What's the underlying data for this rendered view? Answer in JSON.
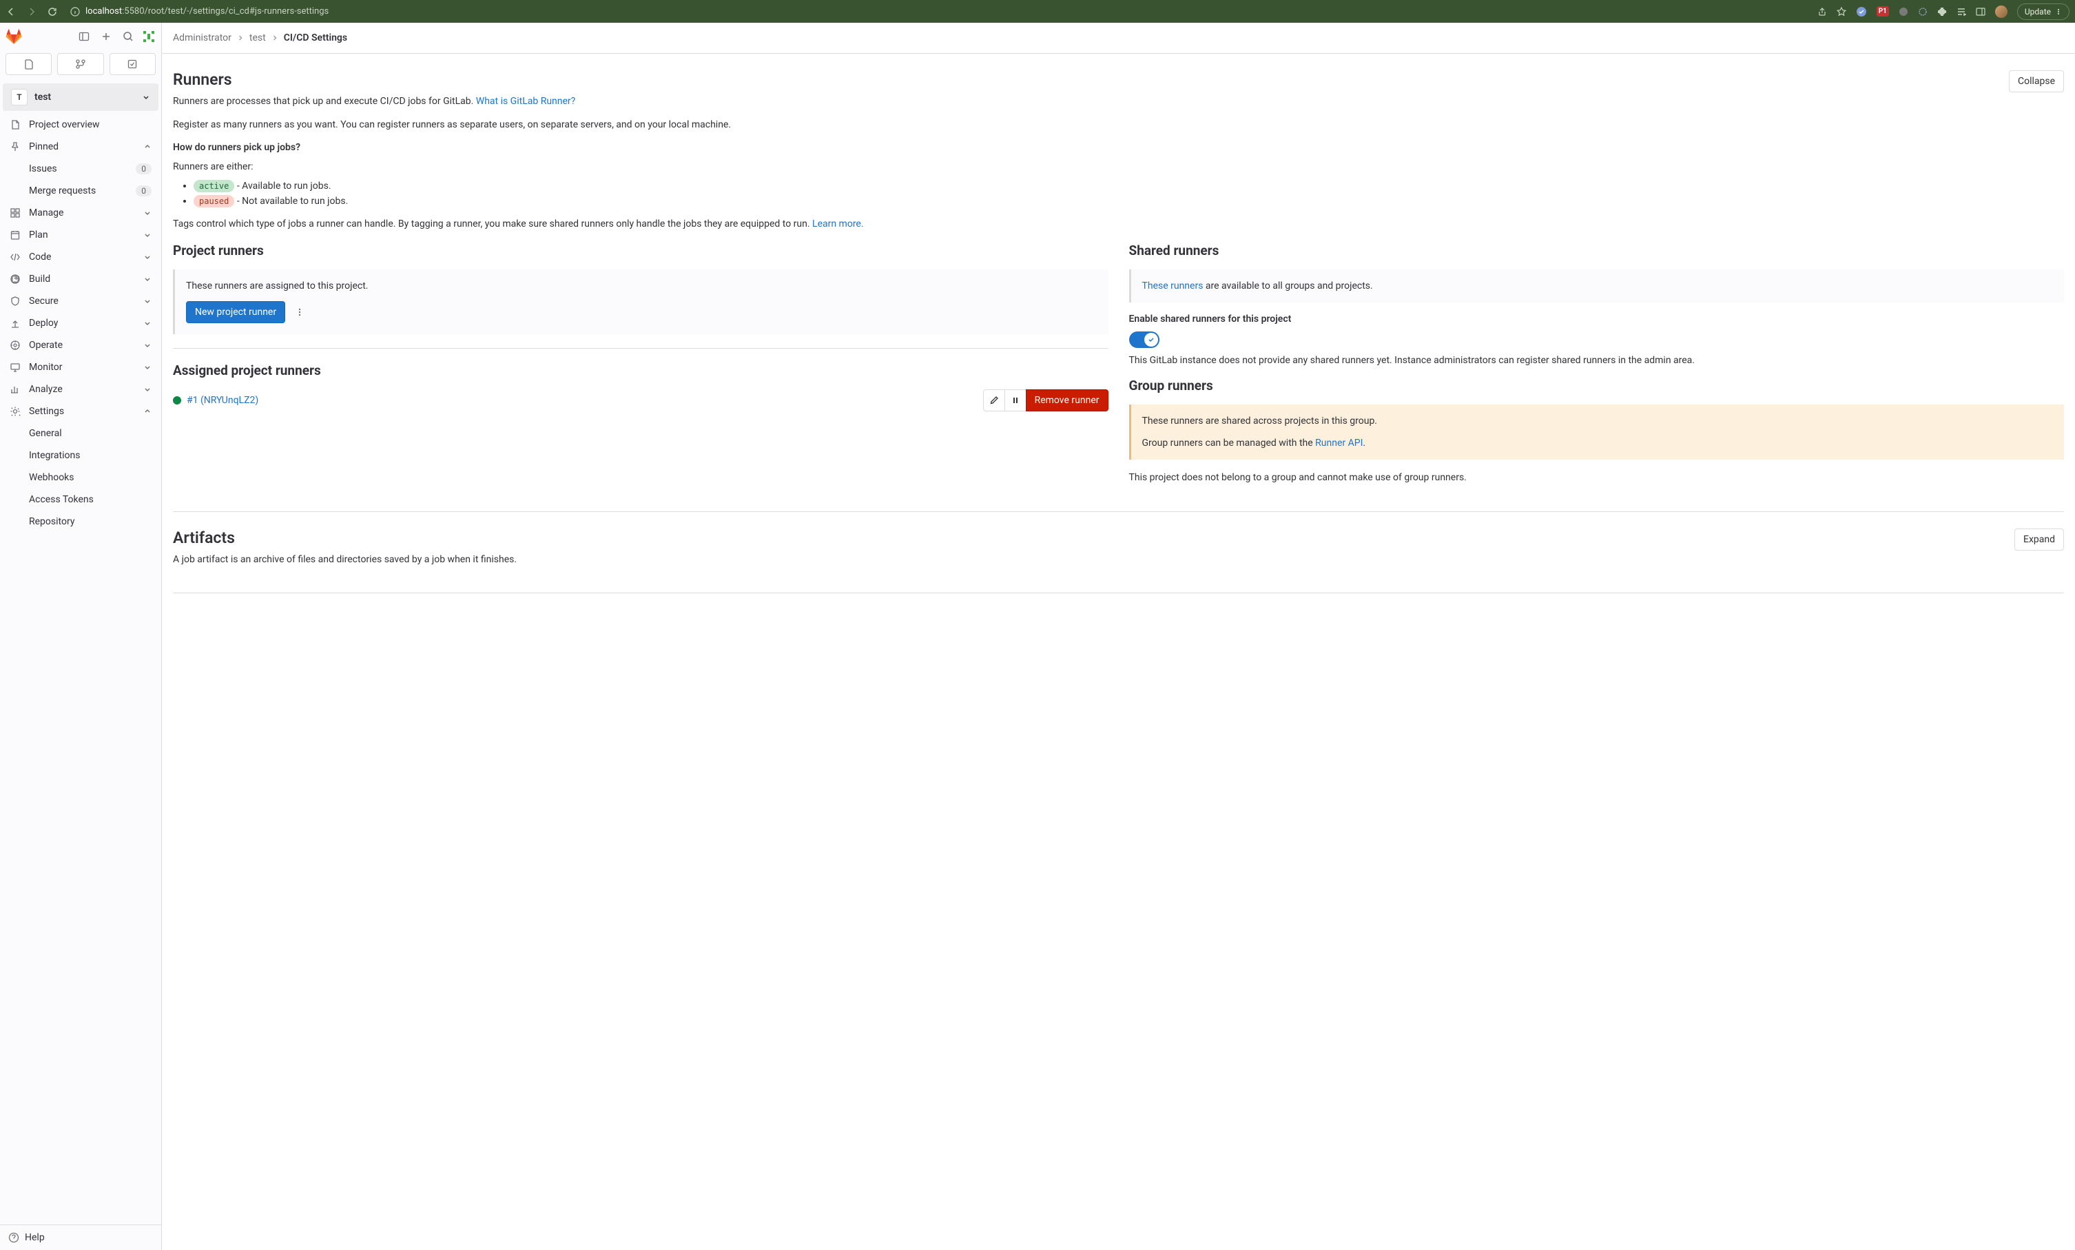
{
  "browser": {
    "url_host": "localhost",
    "url_path": ":5580/root/test/-/settings/ci_cd#js-runners-settings",
    "update_label": "Update",
    "ext_p1": "P1"
  },
  "sidebar": {
    "project_initial": "T",
    "project_name": "test",
    "overview": "Project overview",
    "pinned": "Pinned",
    "issues": {
      "label": "Issues",
      "badge": "0"
    },
    "merge_requests": {
      "label": "Merge requests",
      "badge": "0"
    },
    "manage": "Manage",
    "plan": "Plan",
    "code": "Code",
    "build": "Build",
    "secure": "Secure",
    "deploy": "Deploy",
    "operate": "Operate",
    "monitor": "Monitor",
    "analyze": "Analyze",
    "settings": "Settings",
    "settings_sub": {
      "general": "General",
      "integrations": "Integrations",
      "webhooks": "Webhooks",
      "access_tokens": "Access Tokens",
      "repository": "Repository"
    },
    "help": "Help"
  },
  "breadcrumbs": {
    "crumb1": "Administrator",
    "crumb2": "test",
    "crumb3": "CI/CD Settings"
  },
  "runners": {
    "heading": "Runners",
    "collapse_btn": "Collapse",
    "desc": "Runners are processes that pick up and execute CI/CD jobs for GitLab. ",
    "what_link": "What is GitLab Runner?",
    "register": "Register as many runners as you want. You can register runners as separate users, on separate servers, and on your local machine.",
    "how_head": "How do runners pick up jobs?",
    "either": "Runners are either:",
    "active_label": "active",
    "active_desc": " - Available to run jobs.",
    "paused_label": "paused",
    "paused_desc": " - Not available to run jobs.",
    "tags": "Tags control which type of jobs a runner can handle. By tagging a runner, you make sure shared runners only handle the jobs they are equipped to run. ",
    "learn_more": "Learn more.",
    "project_runners_head": "Project runners",
    "project_runners_desc": "These runners are assigned to this project.",
    "new_runner_btn": "New project runner",
    "assigned_head": "Assigned project runners",
    "runner_name": "#1 (NRYUnqLZ2)",
    "remove_btn": "Remove runner",
    "shared_head": "Shared runners",
    "these_runners": "These runners",
    "shared_desc": " are available to all groups and projects.",
    "enable_shared": "Enable shared runners for this project",
    "shared_note": "This GitLab instance does not provide any shared runners yet. Instance administrators can register shared runners in the admin area.",
    "group_head": "Group runners",
    "group_desc1": "These runners are shared across projects in this group.",
    "group_desc2": "Group runners can be managed with the ",
    "runner_api": "Runner API",
    "group_note": "This project does not belong to a group and cannot make use of group runners."
  },
  "artifacts": {
    "heading": "Artifacts",
    "expand_btn": "Expand",
    "desc": "A job artifact is an archive of files and directories saved by a job when it finishes."
  }
}
